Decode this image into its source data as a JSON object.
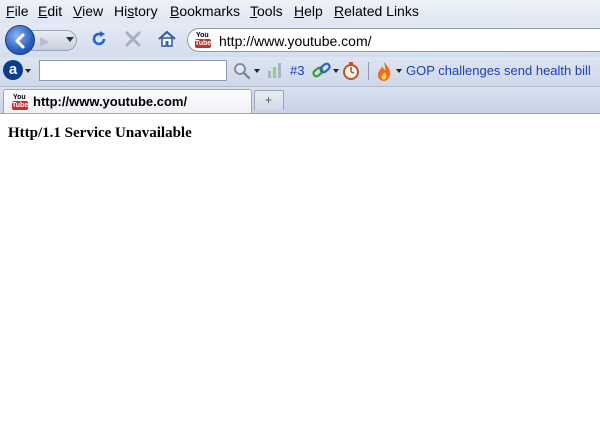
{
  "menu": [
    {
      "acc": "F",
      "rest": "ile"
    },
    {
      "acc": "E",
      "rest": "dit"
    },
    {
      "acc": "V",
      "rest": "iew"
    },
    {
      "pre": "Hi",
      "acc": "s",
      "rest": "tory"
    },
    {
      "acc": "B",
      "rest": "ookmarks"
    },
    {
      "acc": "T",
      "rest": "ools"
    },
    {
      "acc": "H",
      "rest": "elp"
    },
    {
      "acc": "R",
      "rest": "elated Links"
    }
  ],
  "nav": {
    "url": "http://www.youtube.com/",
    "favicon_top": "You",
    "favicon_bottom": "Tube",
    "icons": [
      "back-icon",
      "forward-icon",
      "reload-icon",
      "stop-icon",
      "home-icon"
    ]
  },
  "toolbar": {
    "ask_logo": "a",
    "search_value": "",
    "rank_label": "#3",
    "news_headline": "GOP challenges send health bill"
  },
  "tab": {
    "title": "http://www.youtube.com/",
    "new_tab_symbol": "+"
  },
  "page": {
    "error_message": "Http/1.1 Service Unavailable"
  },
  "colors": {
    "chrome": "#dfe6f2",
    "link_blue": "#1a3fbf",
    "youtube_red": "#c4302b"
  }
}
